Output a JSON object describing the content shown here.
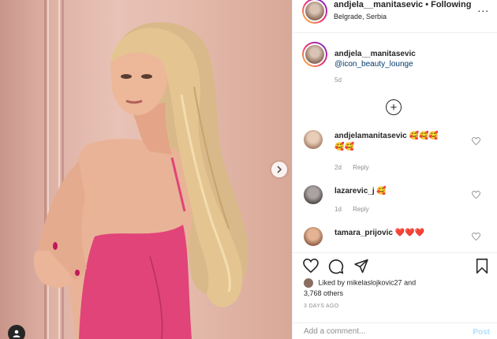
{
  "header": {
    "username": "andjela__manitasevic",
    "separator": "•",
    "follow_label": "Following",
    "location": "Belgrade, Serbia",
    "more_label": "..."
  },
  "caption": {
    "username": "andjela__manitasevic",
    "mention": "@icon_beauty_lounge",
    "time": "5d"
  },
  "comments": [
    {
      "username": "andjelamanitasevic",
      "text": "🥰🥰🥰",
      "text2": "🥰🥰",
      "time": "2d",
      "reply_label": "Reply"
    },
    {
      "username": "lazarevic_j",
      "text": "🥰",
      "time": "1d",
      "reply_label": "Reply"
    },
    {
      "username": "tamara_prijovic",
      "text": "❤️❤️❤️"
    }
  ],
  "likes": {
    "liked_by": "Liked by mikelaslojkovic27 and",
    "count": "3,768 others"
  },
  "post_date": "3 DAYS AGO",
  "add_comment": {
    "placeholder": "Add a comment...",
    "post_label": "Post"
  },
  "colors": {
    "link": "#00376b",
    "post_button": "#b2dffc",
    "dress": "#e04479",
    "wall": "#e3b9ab"
  },
  "icons": [
    "next-arrow-icon",
    "user-tag-icon",
    "more-options-icon",
    "load-more-icon",
    "heart-icon",
    "comment-icon",
    "share-icon",
    "bookmark-icon"
  ]
}
